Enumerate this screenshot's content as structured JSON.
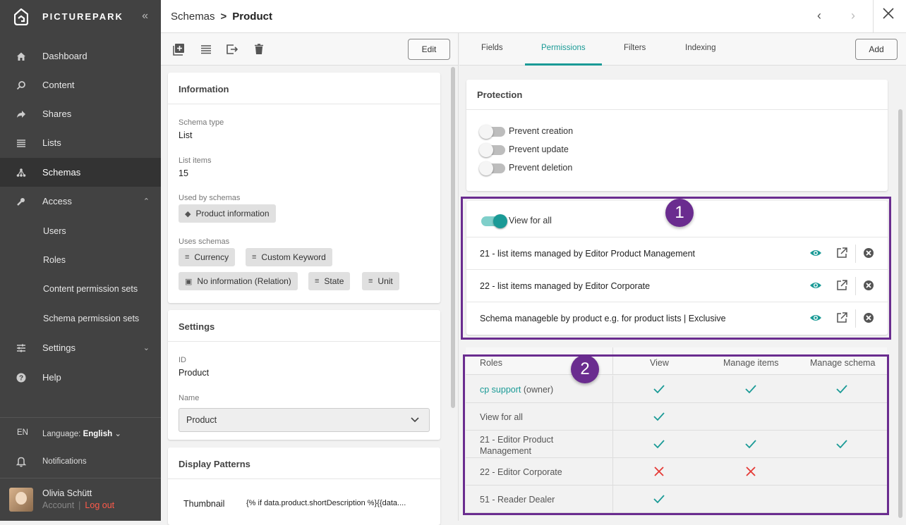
{
  "app": {
    "brand": "PICTUREPARK"
  },
  "sidebar": {
    "items": [
      {
        "label": "Dashboard",
        "icon": "home-icon"
      },
      {
        "label": "Content",
        "icon": "search-icon"
      },
      {
        "label": "Shares",
        "icon": "share-icon"
      },
      {
        "label": "Lists",
        "icon": "list-icon"
      },
      {
        "label": "Schemas",
        "icon": "schema-icon",
        "active": true
      },
      {
        "label": "Access",
        "icon": "wrench-icon",
        "expanded": true
      },
      {
        "label": "Settings",
        "icon": "sliders-icon"
      },
      {
        "label": "Help",
        "icon": "help-icon"
      }
    ],
    "access_sub": [
      "Users",
      "Roles",
      "Content permission sets",
      "Schema permission sets"
    ],
    "lang_code": "EN",
    "language_label": "Language:",
    "language_value": "English",
    "notifications": "Notifications",
    "user": {
      "name": "Olivia Schütt",
      "account": "Account",
      "sep": "|",
      "logout": "Log out"
    }
  },
  "header": {
    "crumb_parent": "Schemas",
    "crumb_sep": ">",
    "crumb_current": "Product"
  },
  "left": {
    "edit_label": "Edit",
    "information": {
      "title": "Information",
      "schema_type_label": "Schema type",
      "schema_type": "List",
      "list_items_label": "List items",
      "list_items": "15",
      "used_by_label": "Used by schemas",
      "used_by": [
        "Product information"
      ],
      "uses_label": "Uses schemas",
      "uses": [
        "Currency",
        "Custom Keyword",
        "No information (Relation)",
        "State",
        "Unit"
      ]
    },
    "settings": {
      "title": "Settings",
      "id_label": "ID",
      "id": "Product",
      "name_label": "Name",
      "name": "Product"
    },
    "display_patterns": {
      "title": "Display Patterns",
      "thumbnail_label": "Thumbnail",
      "thumbnail_value": "{% if data.product.shortDescription %}{{data...."
    }
  },
  "right": {
    "tabs": [
      "Fields",
      "Permissions",
      "Filters",
      "Indexing"
    ],
    "active_tab": "Permissions",
    "add_label": "Add",
    "protection": {
      "title": "Protection",
      "options": [
        {
          "label": "Prevent creation",
          "on": false
        },
        {
          "label": "Prevent update",
          "on": false
        },
        {
          "label": "Prevent deletion",
          "on": false
        }
      ]
    },
    "view_for_all": {
      "label": "View for all",
      "on": true
    },
    "permission_sets": [
      "21 - list items managed by Editor Product Management",
      "22 - list items managed by Editor Corporate",
      "Schema manageble by product e.g. for product lists | Exclusive"
    ],
    "badges": [
      "1",
      "2"
    ],
    "roles_table": {
      "headers": [
        "Roles",
        "View",
        "Manage items",
        "Manage schema"
      ],
      "rows": [
        {
          "role": "cp support",
          "suffix": " (owner)",
          "view": "check",
          "items": "check",
          "schema": "check"
        },
        {
          "role": "View for all",
          "suffix": "",
          "view": "check",
          "items": "",
          "schema": ""
        },
        {
          "role": "21 - Editor Product Management",
          "suffix": "",
          "view": "check",
          "items": "check",
          "schema": "check"
        },
        {
          "role": "22 - Editor Corporate",
          "suffix": "",
          "view": "cross",
          "items": "cross",
          "schema": ""
        },
        {
          "role": "51 - Reader Dealer",
          "suffix": "",
          "view": "check",
          "items": "",
          "schema": ""
        }
      ]
    }
  },
  "colors": {
    "accent": "#1a9a96",
    "highlight": "#6a2c8f",
    "sidebar": "#424242",
    "cross": "#e53935"
  }
}
